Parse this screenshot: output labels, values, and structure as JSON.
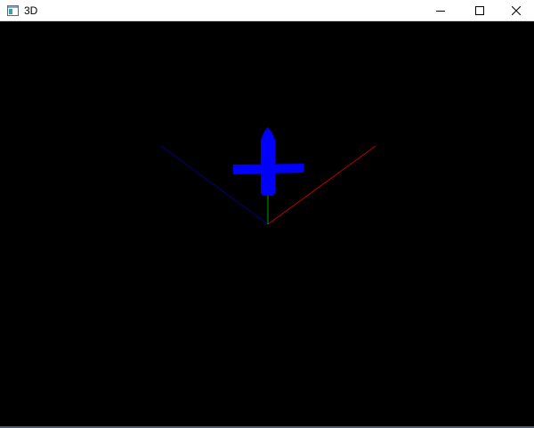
{
  "window": {
    "title": "3D",
    "app_icon": "window-app-icon",
    "controls": {
      "minimize_icon": "minimize-icon",
      "maximize_icon": "maximize-icon",
      "close_icon": "close-icon"
    }
  },
  "scene": {
    "background": "#000000",
    "axes": {
      "x_axis_color": "#c00000",
      "y_axis_color": "#00a000",
      "z_axis_color": "#000080"
    },
    "object": {
      "shape": "plane-cross",
      "color": "#0000ff"
    }
  }
}
